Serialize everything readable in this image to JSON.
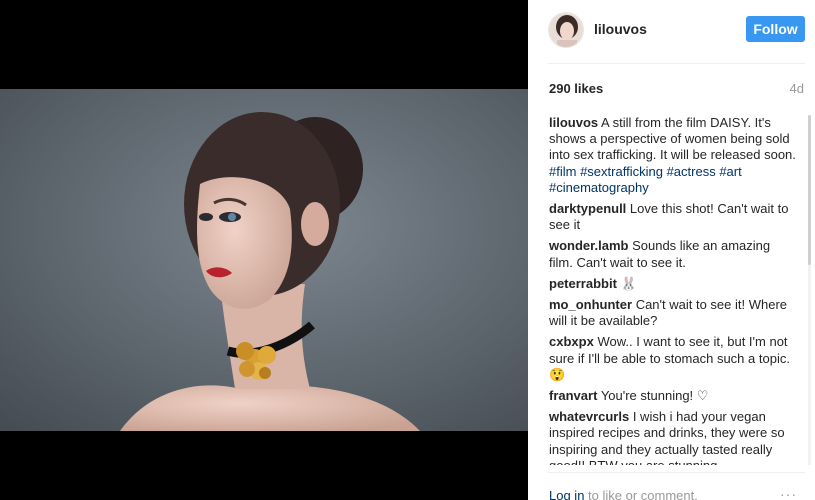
{
  "post": {
    "username": "lilouvos",
    "follow_label": "Follow",
    "likes": "290 likes",
    "age": "4d",
    "photo_alt": "woman-portrait-photo"
  },
  "caption": {
    "username": "lilouvos",
    "text": "A still from the film DAISY. It's shows a perspective of women being sold into sex trafficking. It will be released soon.",
    "tags": [
      "#film",
      "#sextrafficking",
      "#actress",
      "#art",
      "#cinematography"
    ]
  },
  "comments": [
    {
      "username": "darktypenull",
      "text": "Love this shot! Can't wait to see it"
    },
    {
      "username": "wonder.lamb",
      "text": "Sounds like an amazing film. Can't wait to see it."
    },
    {
      "username": "peterrabbit",
      "text": "🐰"
    },
    {
      "username": "mo_onhunter",
      "text": "Can't wait to see it! Where will it be available?"
    },
    {
      "username": "cxbxpx",
      "text": "Wow.. I want to see it, but I'm not sure if I'll be able to stomach such a topic. 😲"
    },
    {
      "username": "franvart",
      "text": "You're stunning! ♡"
    },
    {
      "username": "whatevrcurls",
      "text": "I wish i had your vegan inspired recipes and drinks, they were so inspiring and they actually tasted really good!! BTW you are stunning"
    }
  ],
  "footer": {
    "login_label": "Log in",
    "suffix": "to like or comment.",
    "more_label": "···"
  },
  "colors": {
    "follow_button": "#3897f0",
    "link": "#003569",
    "muted": "#999999"
  }
}
